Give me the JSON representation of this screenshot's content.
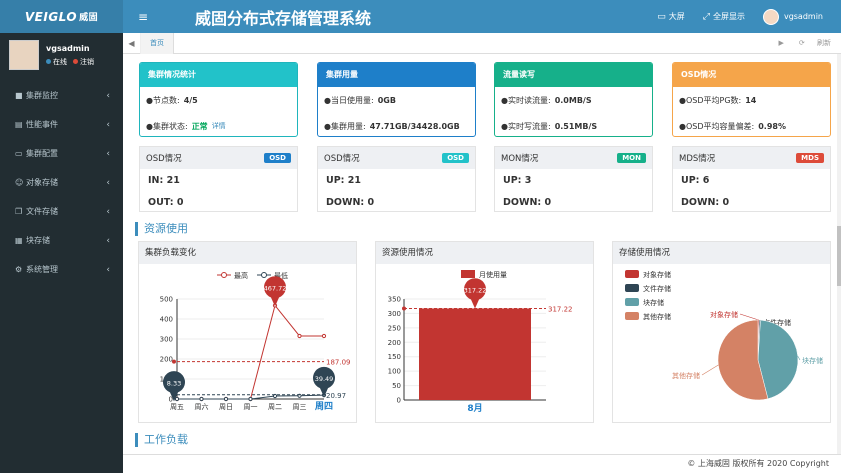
{
  "header": {
    "logo_text": "VEIGLO",
    "logo_sub": "威固",
    "title": "威固分布式存储管理系统",
    "bigscreen": "大屏",
    "fullscreen": "全屏显示",
    "username": "vgsadmin"
  },
  "sidebar": {
    "username": "vgsadmin",
    "status": "在线",
    "logout": "注销",
    "items": [
      {
        "label": "集群监控",
        "icon": "video-icon"
      },
      {
        "label": "性能事件",
        "icon": "document-icon"
      },
      {
        "label": "集群配置",
        "icon": "card-icon"
      },
      {
        "label": "对象存储",
        "icon": "users-icon"
      },
      {
        "label": "文件存储",
        "icon": "copy-icon"
      },
      {
        "label": "块存储",
        "icon": "database-icon"
      },
      {
        "label": "系统管理",
        "icon": "gear-icon"
      }
    ]
  },
  "tabs": {
    "home": "首页",
    "refresh": "刷新"
  },
  "cards": [
    {
      "title": "集群情况统计",
      "color": "#22c2c9",
      "border": "#1fb5bc",
      "rows": [
        {
          "label": "●节点数:",
          "value": "4/5"
        },
        {
          "label": "●集群状态:",
          "status": "正常",
          "link": "详情"
        }
      ]
    },
    {
      "title": "集群用量",
      "color": "#1e7fc9",
      "border": "#1e7fc9",
      "rows": [
        {
          "label": "●当日使用量:",
          "value": "0GB"
        },
        {
          "label": "●集群用量:",
          "value": "47.71GB/34428.0GB"
        }
      ]
    },
    {
      "title": "流量读写",
      "color": "#16b08a",
      "border": "#16b08a",
      "rows": [
        {
          "label": "●实时读流量:",
          "value": "0.0MB/S"
        },
        {
          "label": "●实时写流量:",
          "value": "0.51MB/S"
        }
      ]
    },
    {
      "title": "OSD情况",
      "color": "#f5a54a",
      "border": "#f5a54a",
      "rows": [
        {
          "label": "●OSD平均PG数:",
          "value": "14"
        },
        {
          "label": "●OSD平均容量偏差:",
          "value": "0.98%"
        }
      ]
    }
  ],
  "status_cards": [
    {
      "title": "OSD情况",
      "badge": "OSD",
      "badge_color": "#1e7fc9",
      "rows": [
        "IN:  21",
        "OUT:  0"
      ]
    },
    {
      "title": "OSD情况",
      "badge": "OSD",
      "badge_color": "#22c2c9",
      "rows": [
        "UP:  21",
        "DOWN:  0"
      ]
    },
    {
      "title": "MON情况",
      "badge": "MON",
      "badge_color": "#16b08a",
      "rows": [
        "UP:  3",
        "DOWN:  0"
      ]
    },
    {
      "title": "MDS情况",
      "badge": "MDS",
      "badge_color": "#dd4b39",
      "rows": [
        "UP:  6",
        "DOWN:  0"
      ]
    }
  ],
  "sections": {
    "resource": "资源使用",
    "workload": "工作负载"
  },
  "panels": {
    "load": "集群负载变化",
    "usage": "资源使用情况",
    "storage": "存储使用情况"
  },
  "chart_data": [
    {
      "type": "line",
      "categories": [
        "周五",
        "周六",
        "周日",
        "周一",
        "周二",
        "周三",
        "周四"
      ],
      "highlight_category": "周四",
      "ylim": [
        0,
        500
      ],
      "yticks": [
        0,
        100,
        200,
        300,
        400,
        500
      ],
      "series": [
        {
          "name": "最高",
          "color": "#c23531",
          "values": [
            0,
            0,
            0,
            0,
            467.72,
            315,
            315
          ],
          "max_label": "467.72",
          "average": 187.09,
          "average_label": "187.09"
        },
        {
          "name": "最低",
          "color": "#2f4554",
          "values": [
            0,
            0,
            0,
            0,
            15,
            16,
            19.43
          ],
          "max_label": "39.49",
          "min_label": "8.33",
          "average": 20.97,
          "average_label": "20.97"
        }
      ]
    },
    {
      "type": "bar",
      "categories": [
        "8月"
      ],
      "ylim": [
        0,
        350
      ],
      "yticks": [
        0,
        50,
        100,
        150,
        200,
        250,
        300,
        350
      ],
      "series": [
        {
          "name": "月使用量",
          "color": "#c23531",
          "values": [
            317.22
          ],
          "max_label": "317.22",
          "average_label": "317.22"
        }
      ]
    },
    {
      "type": "pie",
      "slices": [
        {
          "name": "对象存储",
          "value": 0.5,
          "color": "#c23531"
        },
        {
          "name": "文件存储",
          "value": 0.5,
          "color": "#2f4554"
        },
        {
          "name": "块存储",
          "value": 45,
          "color": "#61a0a8"
        },
        {
          "name": "其他存储",
          "value": 54,
          "color": "#d48265"
        }
      ]
    }
  ],
  "footer": "© 上海威固 版权所有 2020 Copyright"
}
